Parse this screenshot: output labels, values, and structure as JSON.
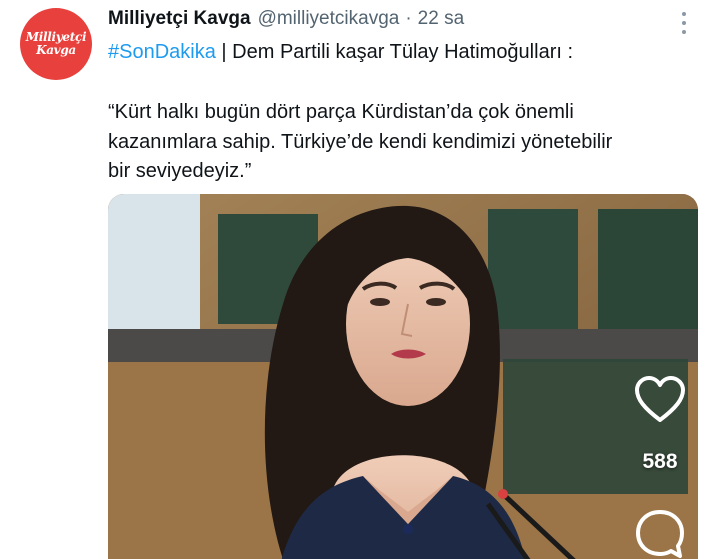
{
  "author": {
    "display_name": "Milliyetçi Kavga",
    "handle": "@milliyetcikavga",
    "separator": "·",
    "time": "22 sa",
    "avatar_text_line1": "Milliyetçi",
    "avatar_text_line2": "Kavga",
    "avatar_color": "#e8413d"
  },
  "post": {
    "hashtag": "#SonDakika",
    "divider": "|",
    "headline": "Dem Partili kaşar Tülay Hatimoğulları :",
    "quote_lines": [
      "“Kürt halkı bugün dört parça Kürdistan’da çok önemli",
      "kazanımlara sahip. Türkiye’de kendi kendimizi yönetebilir",
      "bir seviyedeyiz.”"
    ]
  },
  "actions": {
    "like_icon": "heart-outline-icon",
    "like_count": "588",
    "reply_icon": "speech-bubble-icon",
    "more_icon": "vertical-ellipsis-icon"
  },
  "colors": {
    "link": "#1d9bf0",
    "secondary_text": "#536471",
    "primary_text": "#0f1419"
  }
}
